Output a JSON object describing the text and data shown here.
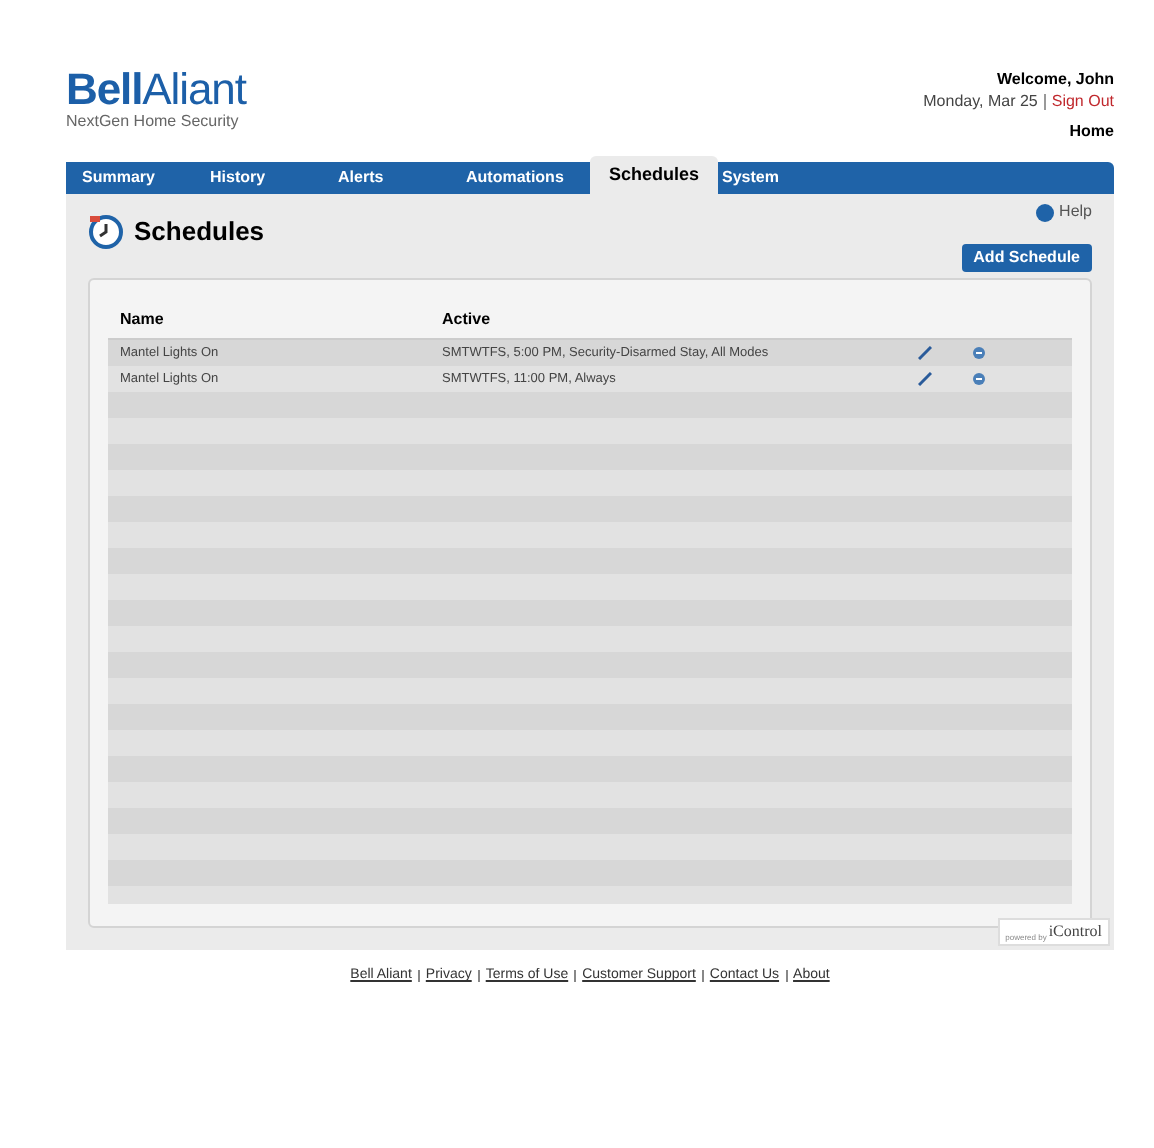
{
  "header": {
    "logo": {
      "brand_bold": "Bell",
      "brand_light": "Aliant",
      "tagline": "NextGen Home Security"
    },
    "welcome": "Welcome, John",
    "date": "Monday, Mar 25",
    "sign_out": "Sign Out",
    "home": "Home"
  },
  "tabs": [
    {
      "label": "Summary",
      "selected": false
    },
    {
      "label": "History",
      "selected": false
    },
    {
      "label": "Alerts",
      "selected": false
    },
    {
      "label": "Automations",
      "selected": false
    },
    {
      "label": "Schedules",
      "selected": true
    },
    {
      "label": "System",
      "selected": false
    }
  ],
  "page": {
    "title": "Schedules",
    "help": "Help",
    "add_button": "Add Schedule"
  },
  "table": {
    "columns": [
      "Name",
      "Active"
    ],
    "rows": [
      {
        "name": "Mantel Lights On",
        "active": "SMTWTFS, 5:00 PM, Security-Disarmed Stay, All Modes"
      },
      {
        "name": "Mantel Lights On",
        "active": "SMTWTFS, 11:00 PM, Always"
      }
    ]
  },
  "powered_by": {
    "prefix": "powered by",
    "brand": "iControl"
  },
  "footer_links": [
    "Bell Aliant",
    "Privacy",
    "Terms of Use",
    "Customer Support",
    "Contact Us",
    "About"
  ]
}
